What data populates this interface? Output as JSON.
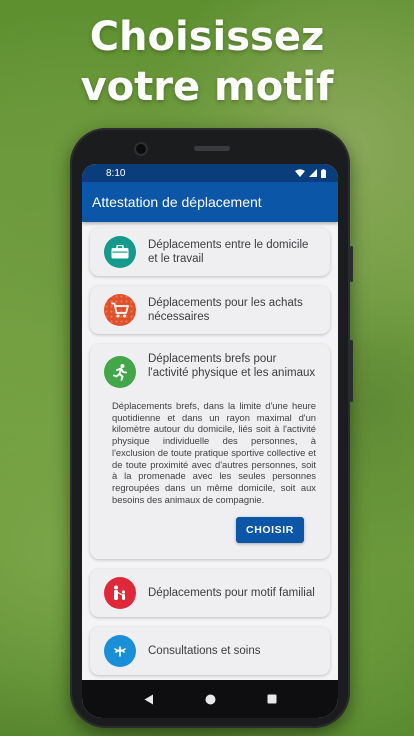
{
  "headline": {
    "line1": "Choisissez",
    "line2": "votre motif"
  },
  "status_bar": {
    "time": "8:10"
  },
  "app_bar": {
    "title": "Attestation de déplacement"
  },
  "reasons": [
    {
      "label": "Déplacements entre le domicile et le travail",
      "icon": "briefcase-icon",
      "color": "#14998c"
    },
    {
      "label": "Déplacements pour les achats nécessaires",
      "icon": "shopping-cart-icon",
      "color": "#e2502a"
    },
    {
      "label": "Déplacements brefs pour l'activité physique et les animaux",
      "icon": "running-person-icon",
      "color": "#43a649",
      "expanded": true,
      "description": "Déplacements brefs, dans la limite d'une heure quotidienne et dans un rayon maximal d'un kilomètre autour du domicile, liés soit à l'activité physique individuelle des personnes, à l'exclusion de toute pratique sportive collective et de toute proximité avec d'autres personnes, soit à la promenade avec les seules personnes regroupées dans un même domicile, soit aux besoins des animaux de compagnie.",
      "button": "CHOISIR"
    },
    {
      "label": "Déplacements pour motif familial",
      "icon": "family-icon",
      "color": "#e0283b"
    },
    {
      "label": "Consultations et soins",
      "icon": "medical-icon",
      "color": "#1a8fd8"
    }
  ],
  "colors": {
    "app_bar": "#0c56a8",
    "status_bar": "#0a3d7c",
    "background": "#6a9838"
  }
}
